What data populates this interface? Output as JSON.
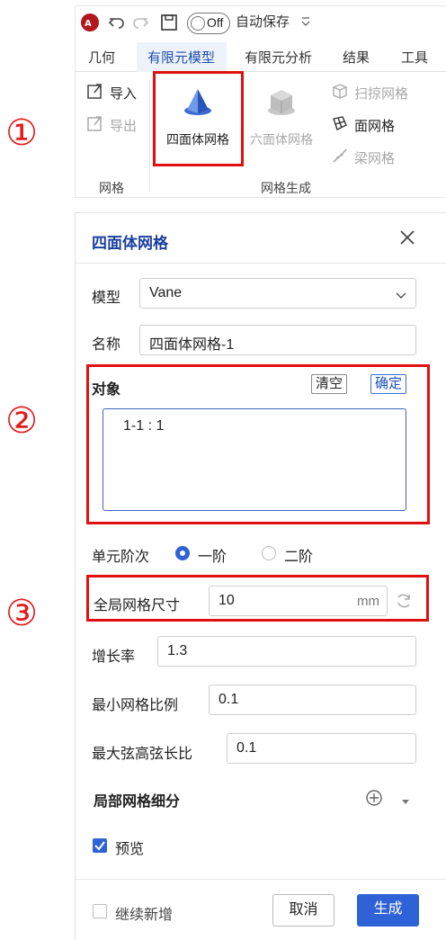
{
  "ribbon": {
    "qat": {
      "app_icon": "app-logo-icon",
      "autosave_toggle": "Off",
      "autosave_label": "自动保存"
    },
    "tabs": [
      "几何",
      "有限元模型",
      "有限元分析",
      "结果",
      "工具"
    ],
    "active_tab": "有限元模型",
    "mesh_group": {
      "label": "网格",
      "import_label": "导入",
      "export_label": "导出"
    },
    "mesh_gen_group": {
      "label": "网格生成",
      "tet_label": "四面体网格",
      "hex_label": "六面体网格",
      "sweep_label": "扫掠网格",
      "surface_label": "面网格",
      "beam_label": "梁网格"
    }
  },
  "markers": [
    "①",
    "②",
    "③"
  ],
  "panel": {
    "title": "四面体网格",
    "model_label": "模型",
    "model_value": "Vane",
    "name_label": "名称",
    "name_value": "四面体网格-1",
    "object_label": "对象",
    "clear_label": "清空",
    "confirm_label": "确定",
    "object_items": [
      "1-1 : 1"
    ],
    "order_label": "单元阶次",
    "order_options": [
      "一阶",
      "二阶"
    ],
    "order_selected": "一阶",
    "global_size_label": "全局网格尺寸",
    "global_size_value": "10",
    "global_size_unit": "mm",
    "growth_label": "增长率",
    "growth_value": "1.3",
    "min_ratio_label": "最小网格比例",
    "min_ratio_value": "0.1",
    "chord_label": "最大弦高弦长比",
    "chord_value": "0.1",
    "local_refine_label": "局部网格细分",
    "preview_label": "预览",
    "preview_checked": true,
    "continue_label": "继续新增",
    "continue_checked": false,
    "cancel_label": "取消",
    "generate_label": "生成"
  },
  "colors": {
    "accent": "#2f62d6",
    "highlight_box": "#e01010",
    "title": "#1c3f9e"
  }
}
